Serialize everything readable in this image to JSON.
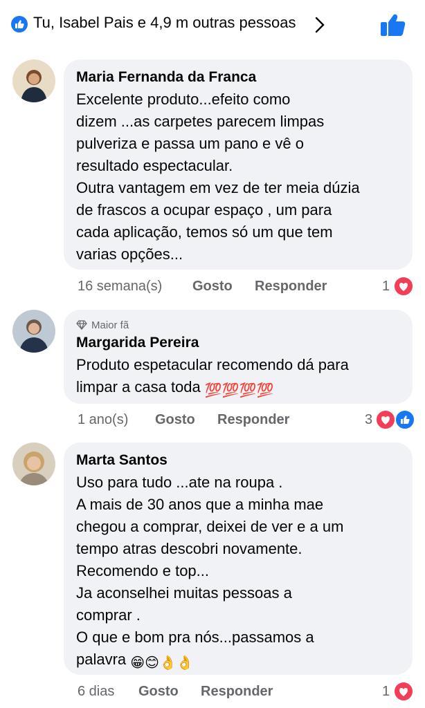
{
  "header": {
    "reactions_text": "Tu, Isabel Pais e 4,9 m outras pessoas",
    "icons": [
      "like-icon",
      "chevron-right-icon",
      "thumbs-up-icon"
    ]
  },
  "colors": {
    "like_blue": "#1877f2",
    "heart_red": "#f33e58",
    "bubble_bg": "#f0f2f5",
    "meta_gray": "#65676b"
  },
  "comments": [
    {
      "author": "Maria Fernanda da Franca",
      "lines": [
        "Excelente produto...efeito como",
        "dizem ...as carpetes parecem limpas",
        "pulveriza e passa um pano e vê o",
        "resultado espectacular.",
        "Outra vantagem em vez de ter meia dúzia",
        "de frascos a ocupar espaço , um para",
        "cada aplicação, temos só um que tem",
        "varias opções..."
      ],
      "time": "16 semana(s)",
      "like_label": "Gosto",
      "reply_label": "Responder",
      "reaction_count": "1"
    },
    {
      "badge": "Maior fã",
      "author": "Margarida Pereira",
      "lines": [
        "Produto  espetacular recomendo dá  para",
        "limpar a casa toda"
      ],
      "emoji": "💯💯💯💯",
      "time": "1 ano(s)",
      "like_label": "Gosto",
      "reply_label": "Responder",
      "reaction_count": "3"
    },
    {
      "author": "Marta Santos",
      "lines": [
        "Uso para tudo ...ate na roupa .",
        "A mais de 30 anos que a minha mae",
        "chegou a comprar, deixei de ver e a um",
        "tempo atras descobri novamente.",
        "Recomendo e top...",
        "Ja aconselhei  muitas pessoas a",
        "comprar .",
        "O que e bom pra nós...passamos a",
        "palavra"
      ],
      "emoji": "😁😊👌👌",
      "time": "6 dias",
      "like_label": "Gosto",
      "reply_label": "Responder",
      "reaction_count": "1"
    }
  ]
}
